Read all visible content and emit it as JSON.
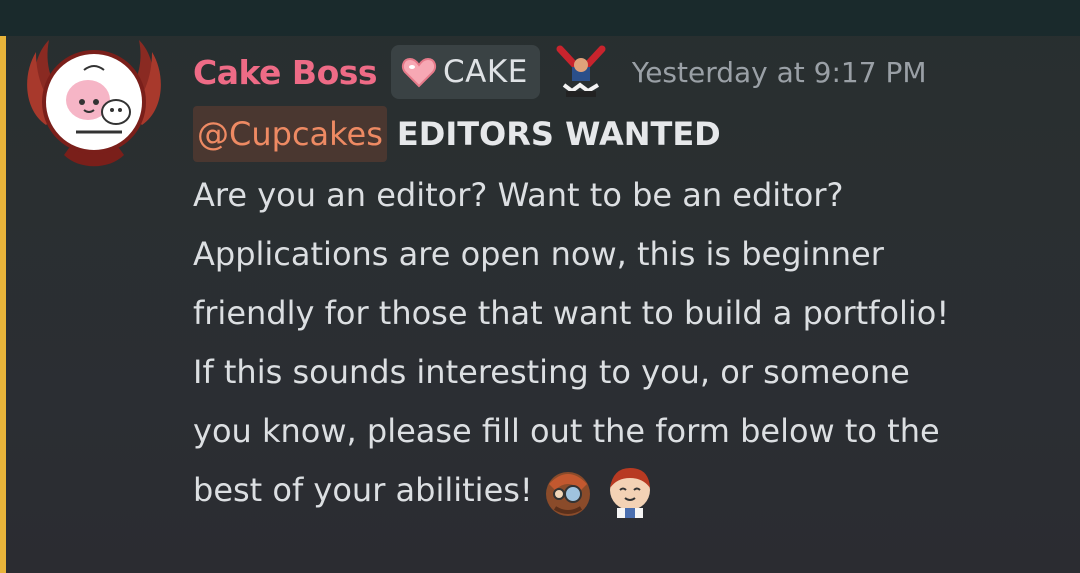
{
  "message": {
    "author": "Cake Boss",
    "role_tag": {
      "label": "CAKE",
      "icon": "heart-icon"
    },
    "badge_icon": "crossed-swords-badge-icon",
    "timestamp": "Yesterday at 9:17 PM",
    "mention": "@Cupcakes",
    "headline": "EDITORS WANTED",
    "lines": [
      "Are you an editor? Want to be an editor?",
      "Applications are open now, this is beginner",
      "friendly for those that want to build a portfolio!",
      "If this sounds interesting to you, or someone",
      "you know, please fill out the form below to the",
      "best of your abilities!"
    ],
    "emojis": [
      "cookie-character-emoji",
      "smiling-cookie-emoji"
    ]
  },
  "colors": {
    "author": "#ee6b86",
    "mention_text": "#ee8a63",
    "mention_bg": "#4a3730",
    "mention_bar": "#e8b43a",
    "timestamp": "#9aa0a6",
    "body_text": "#dcdfe2"
  }
}
